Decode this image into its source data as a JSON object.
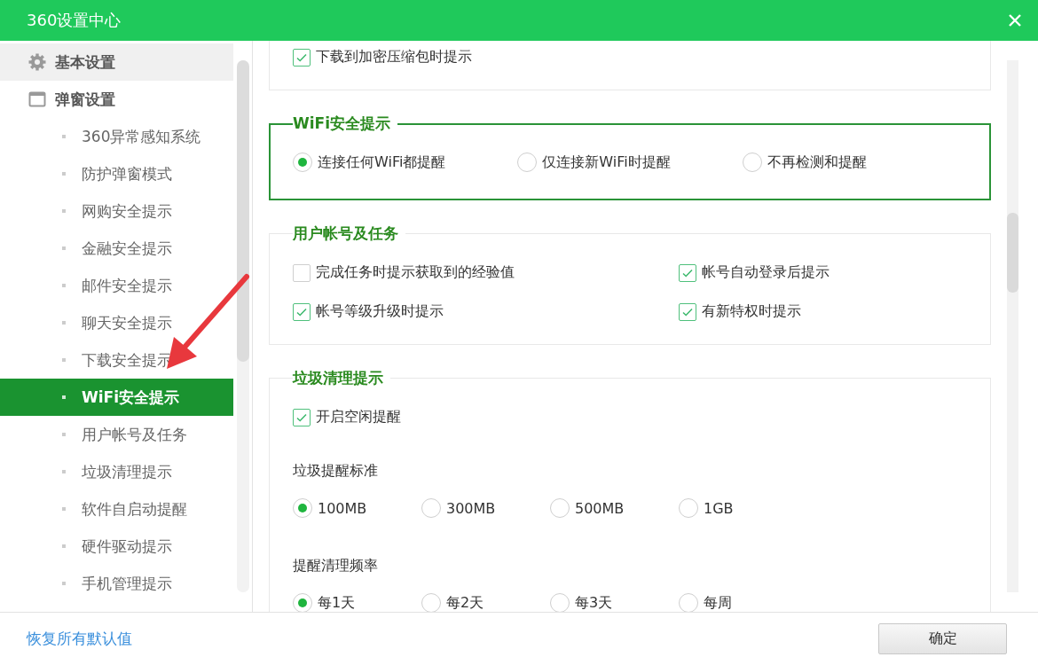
{
  "window": {
    "title": "360设置中心"
  },
  "sidebar": {
    "groups": [
      {
        "label": "基本设置",
        "kind": "gear",
        "hovered": true
      },
      {
        "label": "弹窗设置",
        "kind": "window",
        "hovered": false,
        "children": [
          {
            "label": "360异常感知系统",
            "selected": false
          },
          {
            "label": "防护弹窗模式",
            "selected": false
          },
          {
            "label": "网购安全提示",
            "selected": false
          },
          {
            "label": "金融安全提示",
            "selected": false
          },
          {
            "label": "邮件安全提示",
            "selected": false
          },
          {
            "label": "聊天安全提示",
            "selected": false
          },
          {
            "label": "下载安全提示",
            "selected": false
          },
          {
            "label": "WiFi安全提示",
            "selected": true
          },
          {
            "label": "用户帐号及任务",
            "selected": false
          },
          {
            "label": "垃圾清理提示",
            "selected": false
          },
          {
            "label": "软件自启动提醒",
            "selected": false
          },
          {
            "label": "硬件驱动提示",
            "selected": false
          },
          {
            "label": "手机管理提示",
            "selected": false
          }
        ]
      }
    ]
  },
  "sections": [
    {
      "highlighted": false,
      "items": [
        {
          "kind": "checkbox",
          "label": "下载到加密压缩包时提示",
          "checked": true
        }
      ]
    },
    {
      "title": "WiFi安全提示",
      "highlighted": true,
      "items": [
        {
          "kind": "radios",
          "options": [
            {
              "label": "连接任何WiFi都提醒",
              "selected": true
            },
            {
              "label": "仅连接新WiFi时提醒",
              "selected": false
            },
            {
              "label": "不再检测和提醒",
              "selected": false
            }
          ]
        }
      ]
    },
    {
      "title": "用户帐号及任务",
      "highlighted": false,
      "items": [
        {
          "kind": "grid",
          "items": [
            {
              "label": "完成任务时提示获取到的经验值",
              "checked": false
            },
            {
              "label": "帐号自动登录后提示",
              "checked": true
            },
            {
              "label": "帐号等级升级时提示",
              "checked": true
            },
            {
              "label": "有新特权时提示",
              "checked": true
            }
          ]
        }
      ]
    },
    {
      "title": "垃圾清理提示",
      "highlighted": false,
      "items": [
        {
          "kind": "checkbox",
          "label": "开启空闲提醒",
          "checked": true
        },
        {
          "kind": "label",
          "text": "垃圾提醒标准"
        },
        {
          "kind": "radios",
          "options": [
            {
              "label": "100MB",
              "selected": true
            },
            {
              "label": "300MB",
              "selected": false
            },
            {
              "label": "500MB",
              "selected": false
            },
            {
              "label": "1GB",
              "selected": false
            }
          ]
        },
        {
          "kind": "label",
          "text": "提醒清理频率"
        },
        {
          "kind": "radios",
          "options": [
            {
              "label": "每1天",
              "selected": true
            },
            {
              "label": "每2天",
              "selected": false
            },
            {
              "label": "每3天",
              "selected": false
            },
            {
              "label": "每周",
              "selected": false
            }
          ]
        }
      ]
    }
  ],
  "footer": {
    "link": "恢复所有默认值",
    "button": "确定"
  }
}
